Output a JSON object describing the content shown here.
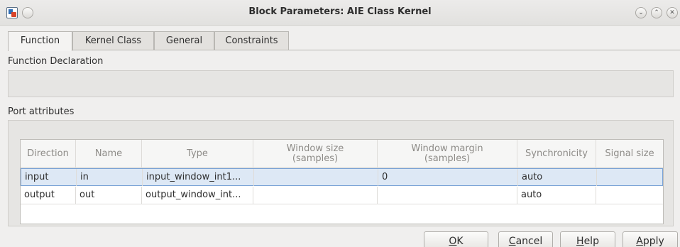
{
  "window": {
    "title": "Block Parameters: AIE Class Kernel",
    "controls": [
      "chevron-down-icon",
      "chevron-up-icon",
      "close-icon"
    ]
  },
  "tabs": [
    {
      "label": "Function",
      "active": true
    },
    {
      "label": "Kernel Class",
      "active": false
    },
    {
      "label": "General",
      "active": false
    },
    {
      "label": "Constraints",
      "active": false
    }
  ],
  "function_declaration": {
    "label": "Function Declaration",
    "value": ""
  },
  "port_attributes": {
    "label": "Port attributes",
    "columns": [
      "Direction",
      "Name",
      "Type",
      "Window size\n(samples)",
      "Window margin\n(samples)",
      "Synchronicity",
      "Signal size"
    ],
    "rows": [
      {
        "direction": "input",
        "name": "in",
        "type": "input_window_int1...",
        "window_size": "",
        "window_margin": "0",
        "synchronicity": "auto",
        "signal_size": "",
        "selected": true
      },
      {
        "direction": "output",
        "name": "out",
        "type": "output_window_int...",
        "window_size": "",
        "window_margin": "",
        "synchronicity": "auto",
        "signal_size": "",
        "selected": false
      }
    ]
  },
  "buttons": {
    "ok": {
      "mnemonic": "O",
      "rest": "K"
    },
    "cancel": {
      "mnemonic": "C",
      "rest": "ancel"
    },
    "help": {
      "mnemonic": "H",
      "rest": "elp"
    },
    "apply": {
      "mnemonic": "A",
      "rest": "pply"
    }
  },
  "colors": {
    "selected_row": "#dde8f5",
    "selected_border": "#7aa3d6",
    "header_text": "#8d8b87"
  }
}
